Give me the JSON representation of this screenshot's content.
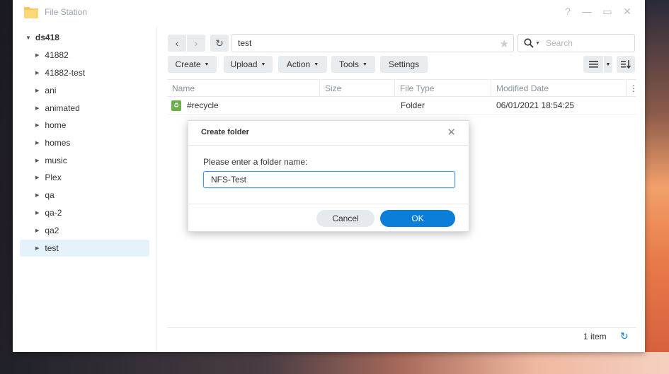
{
  "window": {
    "title": "File Station",
    "help": "?",
    "minimize": "—",
    "maximize": "▭",
    "close": "✕"
  },
  "sidebar": {
    "root": "ds418",
    "items": [
      "41882",
      "41882-test",
      "ani",
      "animated",
      "home",
      "homes",
      "music",
      "Plex",
      "qa",
      "qa-2",
      "qa2",
      "test"
    ],
    "selected": "test"
  },
  "toolbar": {
    "back": "‹",
    "forward": "›",
    "refresh": "↻",
    "path": "test",
    "search_placeholder": "Search",
    "create_label": "Create",
    "upload_label": "Upload",
    "action_label": "Action",
    "tools_label": "Tools",
    "settings_label": "Settings"
  },
  "table": {
    "columns": [
      "Name",
      "Size",
      "File Type",
      "Modified Date"
    ],
    "rows": [
      {
        "name": "#recycle",
        "size": "",
        "type": "Folder",
        "modified": "06/01/2021 18:54:25"
      }
    ]
  },
  "status": {
    "count": "1 item"
  },
  "dialog": {
    "title": "Create folder",
    "close": "✕",
    "label": "Please enter a folder name:",
    "input_value": "NFS-Test",
    "cancel_label": "Cancel",
    "ok_label": "OK"
  },
  "colors": {
    "accent": "#0a7ed8",
    "selected_bg": "#e5f2fc"
  }
}
